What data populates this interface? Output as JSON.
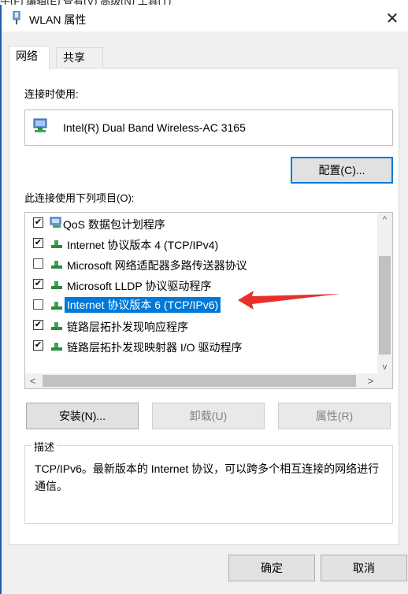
{
  "menubar_fragment": "‪牛(F)   编辑(E)   查看(V)   高级(N)   工具(T)",
  "window": {
    "title": "WLAN 属性",
    "close_glyph": "✕"
  },
  "tabs": [
    {
      "label": "网络",
      "active": true
    },
    {
      "label": "共享",
      "active": false
    }
  ],
  "connect_using_label": "连接时使用:",
  "adapter_name": "Intel(R) Dual Band Wireless-AC 3165",
  "configure_button": "配置(C)...",
  "items_label": "此连接使用下列项目(O):",
  "items": [
    {
      "label": "QoS 数据包计划程序",
      "checked": true,
      "icon": "qos-icon",
      "selected": false
    },
    {
      "label": "Internet 协议版本 4 (TCP/IPv4)",
      "checked": true,
      "icon": "protocol-icon",
      "selected": false
    },
    {
      "label": "Microsoft 网络适配器多路传送器协议",
      "checked": false,
      "icon": "protocol-icon",
      "selected": false
    },
    {
      "label": "Microsoft LLDP 协议驱动程序",
      "checked": true,
      "icon": "protocol-icon",
      "selected": false
    },
    {
      "label": "Internet 协议版本 6 (TCP/IPv6)",
      "checked": false,
      "icon": "protocol-icon",
      "selected": true
    },
    {
      "label": "链路层拓扑发现响应程序",
      "checked": true,
      "icon": "protocol-icon",
      "selected": false
    },
    {
      "label": "链路层拓扑发现映射器 I/O 驱动程序",
      "checked": true,
      "icon": "protocol-icon",
      "selected": false
    }
  ],
  "scroll_glyphs": {
    "up": "^",
    "down": "v",
    "left": "<",
    "right": ">"
  },
  "buttons": {
    "install": "安装(N)...",
    "uninstall": "卸载(U)",
    "properties": "属性(R)"
  },
  "description": {
    "title": "描述",
    "text": "TCP/IPv6。最新版本的 Internet 协议，可以跨多个相互连接的网络进行通信。"
  },
  "footer": {
    "ok": "确定",
    "cancel": "取消"
  },
  "colors": {
    "selection": "#0078d7",
    "arrow": "#e8302a",
    "face": "#f0f0f0"
  }
}
